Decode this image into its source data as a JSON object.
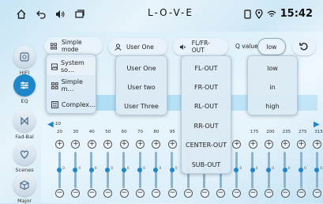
{
  "status": {
    "title": "L-O-V-E",
    "time": "15:42"
  },
  "sidebar": {
    "items": [
      {
        "label": "HIFI"
      },
      {
        "label": "EQ"
      },
      {
        "label": "Fad-Bal"
      },
      {
        "label": "Scenes"
      },
      {
        "label": "Major"
      }
    ]
  },
  "toolbar": {
    "mode_label": "Simple mode",
    "user_label": "User One",
    "output_label": "FL/FR-OUT",
    "q_label": "Q value",
    "q_value": "low"
  },
  "mode_menu": [
    "System so…",
    "Simple m…",
    "Complex…"
  ],
  "user_menu": [
    "User One",
    "User two",
    "User Three"
  ],
  "output_menu": [
    "FL-OUT",
    "FR-OUT",
    "RL-OUT",
    "RR-OUT",
    "CENTER-OUT",
    "SUB-OUT"
  ],
  "q_menu": [
    "low",
    "in",
    "high"
  ],
  "eq": {
    "scale_left": "-10",
    "frequencies": [
      "20",
      "30",
      "40",
      "50",
      "60",
      "70",
      "80",
      "95",
      "",
      "",
      "",
      "",
      "175",
      "200",
      "235",
      "275",
      "315"
    ],
    "zero": "0"
  }
}
